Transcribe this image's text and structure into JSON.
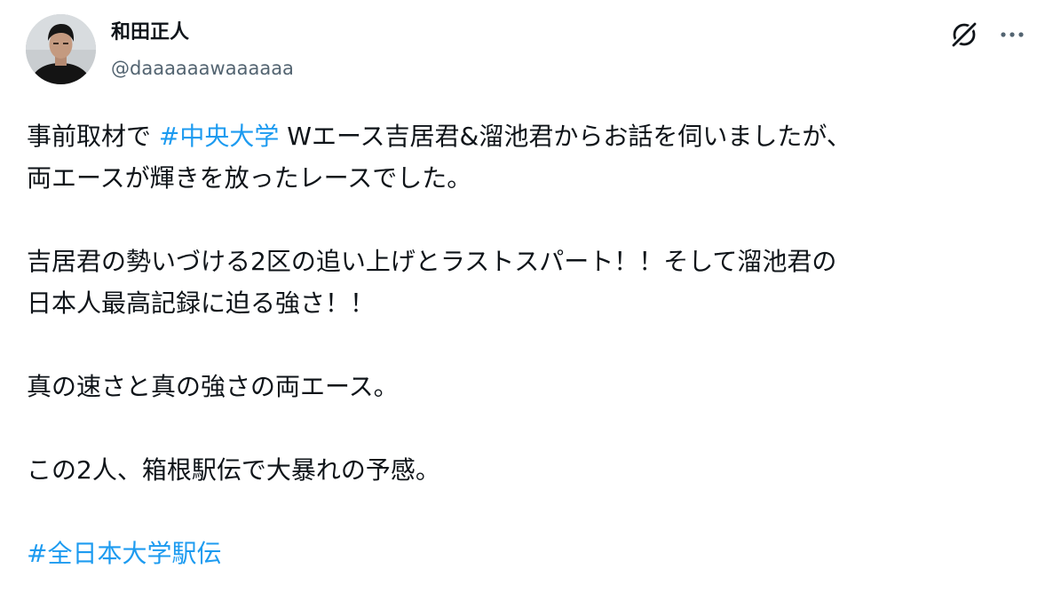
{
  "author": {
    "display_name": "和田正人",
    "handle": "@daaaaaawaaaaaa",
    "avatar_icon": "avatar-photo"
  },
  "actions": {
    "grok_icon": "grok-slash-icon",
    "more_icon": "more-horizontal-icon"
  },
  "post": {
    "line1_before": "事前取材で ",
    "hashtag_chuo": "#中央大学",
    "line1_after": " Wエース吉居君&溜池君からお話を伺いましたが、",
    "line2": "両エースが輝きを放ったレースでした。",
    "line3": "吉居君の勢いづける2区の追い上げとラストスパート！！そして溜池君の",
    "line4": "日本人最高記録に迫る強さ！！",
    "line5": "真の速さと真の強さの両エース。",
    "line6": "この2人、箱根駅伝で大暴れの予感。",
    "hashtag_ekiden": "#全日本大学駅伝"
  },
  "colors": {
    "text": "#0f1419",
    "secondary": "#536471",
    "link": "#1d9bf0",
    "background": "#ffffff"
  }
}
